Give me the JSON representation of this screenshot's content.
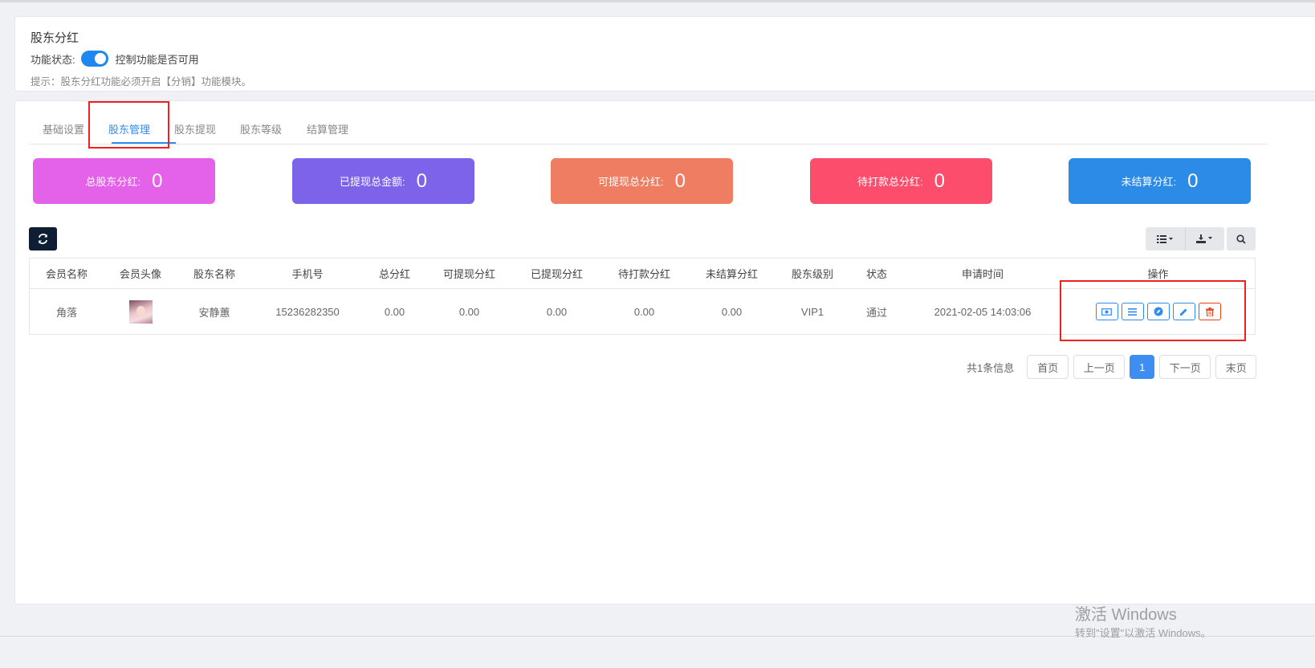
{
  "header": {
    "title": "股东分红",
    "status_label": "功能状态:",
    "toggle_on": true,
    "status_desc": "控制功能是否可用",
    "tip": "提示：股东分红功能必须开启【分销】功能模块。"
  },
  "tabs": [
    {
      "label": "基础设置",
      "active": false
    },
    {
      "label": "股东管理",
      "active": true
    },
    {
      "label": "股东提现",
      "active": false
    },
    {
      "label": "股东等级",
      "active": false
    },
    {
      "label": "结算管理",
      "active": false
    }
  ],
  "stats": [
    {
      "label": "总股东分红:",
      "value": "0",
      "color": "#e462ea"
    },
    {
      "label": "已提现总金额:",
      "value": "0",
      "color": "#7c63ea"
    },
    {
      "label": "可提现总分红:",
      "value": "0",
      "color": "#ee7d62"
    },
    {
      "label": "待打款总分红:",
      "value": "0",
      "color": "#fc4d6d"
    },
    {
      "label": "未结算分红:",
      "value": "0",
      "color": "#2b8be6"
    }
  ],
  "table": {
    "columns": [
      "会员名称",
      "会员头像",
      "股东名称",
      "手机号",
      "总分红",
      "可提现分红",
      "已提现分红",
      "待打款分红",
      "未结算分红",
      "股东级别",
      "状态",
      "申请时间",
      "操作"
    ],
    "rows": [
      {
        "member_name": "角落",
        "shareholder_name": "安静蕙",
        "phone": "15236282350",
        "total": "0.00",
        "withdrawable": "0.00",
        "withdrawn": "0.00",
        "pending": "0.00",
        "unsettled": "0.00",
        "level": "VIP1",
        "status": "通过",
        "apply_time": "2021-02-05 14:03:06"
      }
    ]
  },
  "pagination": {
    "total_text": "共1条信息",
    "first": "首页",
    "prev": "上一页",
    "current": "1",
    "next": "下一页",
    "last": "末页"
  },
  "watermark": {
    "line1": "激活 Windows",
    "line2": "转到\"设置\"以激活 Windows。"
  },
  "colors": {
    "accent": "#2d8cf0",
    "danger": "#ed4014",
    "highlight": "#ee2020"
  }
}
